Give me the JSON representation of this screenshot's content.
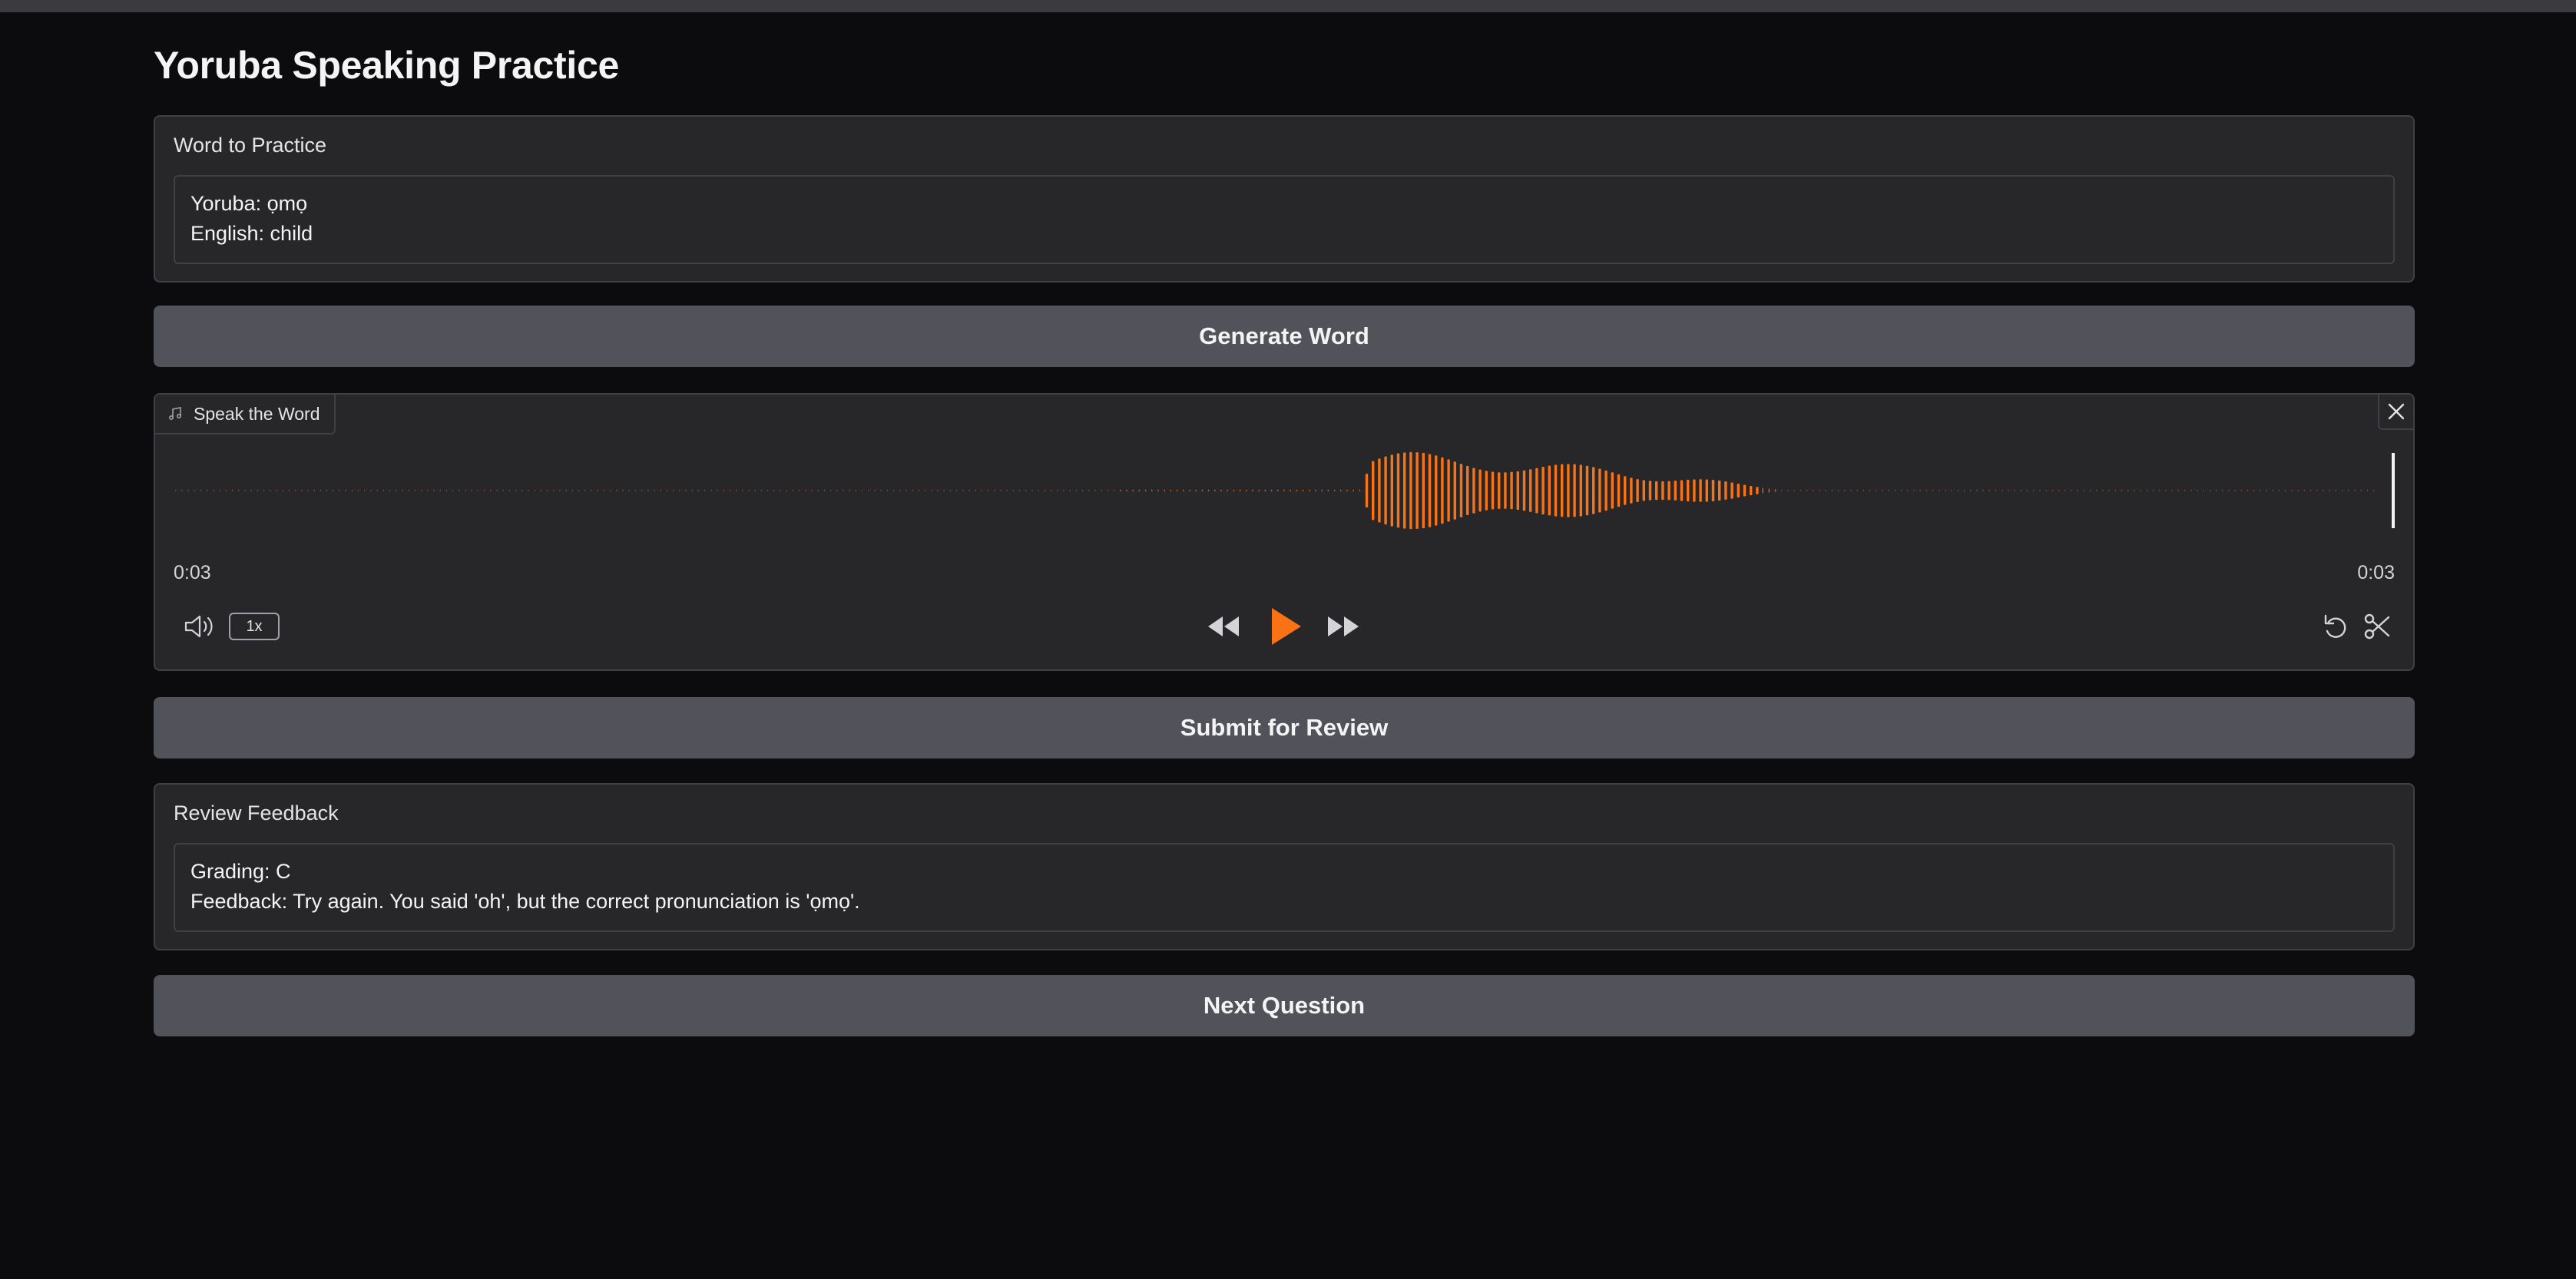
{
  "page": {
    "title": "Yoruba Speaking Practice"
  },
  "word_panel": {
    "label": "Word to Practice",
    "line1": "Yoruba: ọmọ",
    "line2": "English: child"
  },
  "buttons": {
    "generate": "Generate Word",
    "submit": "Submit for Review",
    "next": "Next Question"
  },
  "audio": {
    "label": "Speak the Word",
    "current_time": "0:03",
    "duration": "0:03",
    "playback_rate": "1x",
    "waveform_color": "#f97316",
    "icons": [
      "music-note-icon",
      "close-icon",
      "volume-icon",
      "rewind-icon",
      "play-icon",
      "fast-forward-icon",
      "undo-icon",
      "trim-icon"
    ]
  },
  "feedback_panel": {
    "label": "Review Feedback",
    "line1": "Grading: C",
    "line2": "Feedback: Try again. You said 'oh', but the correct pronunciation is 'ọmọ'."
  },
  "colors": {
    "background": "#0c0c0f",
    "panel": "#27272a",
    "button": "#52525b",
    "accent": "#f97316"
  }
}
